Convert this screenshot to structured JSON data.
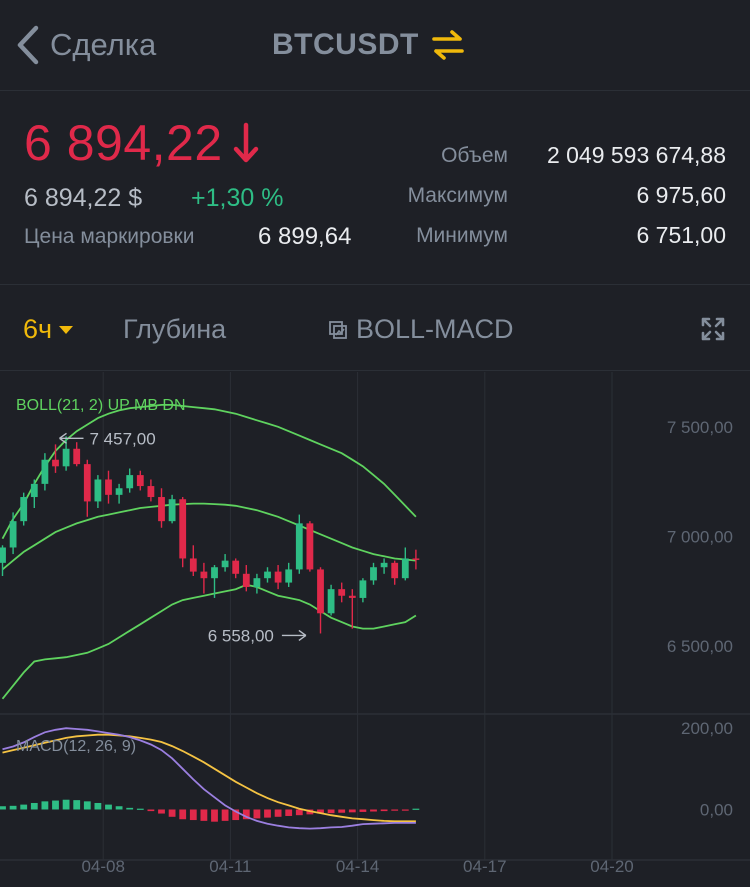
{
  "header": {
    "back_label": "Сделка",
    "pair": "BTCUSDT",
    "back_icon": "chevron-left-icon",
    "swap_icon": "swap-arrows-icon"
  },
  "ticker": {
    "last_price": "6 894,22",
    "last_price_usd": "6 894,22 $",
    "change_percent": "+1,30 %",
    "mark_price_label": "Цена маркировки",
    "mark_price_value": "6 899,64",
    "stats": [
      {
        "label": "Объем",
        "value": "2 049 593 674,88"
      },
      {
        "label": "Максимум",
        "value": "6 975,60"
      },
      {
        "label": "Минимум",
        "value": "6 751,00"
      }
    ]
  },
  "tabs": {
    "interval": "6ч",
    "depth": "Глубина",
    "indicator": "BOLL-MACD"
  },
  "colors": {
    "background": "#1e2026",
    "up": "#2ebd85",
    "down": "#e0294a",
    "accent": "#f0b90b",
    "boll": "#5fd35f",
    "macd_line": "#f5c343",
    "signal_line": "#9b7fe0"
  },
  "chart_data": [
    {
      "type": "candlestick",
      "legend": "BOLL(21, 2) UP MB DN",
      "ylim": [
        6200,
        7750
      ],
      "y_ticks": [
        "7 500,00",
        "7 000,00",
        "6 500,00"
      ],
      "y_tick_values": [
        7500,
        7000,
        6500
      ],
      "x_ticks": [
        "04-08",
        "04-11",
        "04-14",
        "04-17",
        "04-20"
      ],
      "x_tick_values": [
        9.5,
        21.5,
        33.5,
        45.5,
        57.5
      ],
      "annotations": [
        {
          "text": "7 457,00",
          "index": 5,
          "value": 7457
        },
        {
          "text": "6 558,00",
          "index": 29,
          "value": 6558
        }
      ],
      "candles": [
        {
          "o": 6880,
          "h": 6960,
          "l": 6820,
          "c": 6950
        },
        {
          "o": 6950,
          "h": 7110,
          "l": 6920,
          "c": 7070
        },
        {
          "o": 7070,
          "h": 7200,
          "l": 7050,
          "c": 7180
        },
        {
          "o": 7180,
          "h": 7260,
          "l": 7130,
          "c": 7240
        },
        {
          "o": 7240,
          "h": 7380,
          "l": 7210,
          "c": 7350
        },
        {
          "o": 7350,
          "h": 7420,
          "l": 7290,
          "c": 7320
        },
        {
          "o": 7320,
          "h": 7457,
          "l": 7300,
          "c": 7400
        },
        {
          "o": 7400,
          "h": 7430,
          "l": 7320,
          "c": 7330
        },
        {
          "o": 7330,
          "h": 7350,
          "l": 7090,
          "c": 7160
        },
        {
          "o": 7160,
          "h": 7280,
          "l": 7130,
          "c": 7260
        },
        {
          "o": 7260,
          "h": 7300,
          "l": 7150,
          "c": 7190
        },
        {
          "o": 7190,
          "h": 7240,
          "l": 7150,
          "c": 7220
        },
        {
          "o": 7220,
          "h": 7310,
          "l": 7200,
          "c": 7280
        },
        {
          "o": 7280,
          "h": 7300,
          "l": 7210,
          "c": 7230
        },
        {
          "o": 7230,
          "h": 7260,
          "l": 7160,
          "c": 7180
        },
        {
          "o": 7180,
          "h": 7220,
          "l": 7040,
          "c": 7070
        },
        {
          "o": 7070,
          "h": 7190,
          "l": 7060,
          "c": 7170
        },
        {
          "o": 7170,
          "h": 7180,
          "l": 6860,
          "c": 6900
        },
        {
          "o": 6900,
          "h": 6960,
          "l": 6820,
          "c": 6840
        },
        {
          "o": 6840,
          "h": 6880,
          "l": 6740,
          "c": 6810
        },
        {
          "o": 6810,
          "h": 6870,
          "l": 6720,
          "c": 6860
        },
        {
          "o": 6860,
          "h": 6920,
          "l": 6840,
          "c": 6890
        },
        {
          "o": 6890,
          "h": 6900,
          "l": 6810,
          "c": 6830
        },
        {
          "o": 6830,
          "h": 6870,
          "l": 6750,
          "c": 6770
        },
        {
          "o": 6770,
          "h": 6830,
          "l": 6740,
          "c": 6810
        },
        {
          "o": 6810,
          "h": 6860,
          "l": 6790,
          "c": 6840
        },
        {
          "o": 6840,
          "h": 6870,
          "l": 6760,
          "c": 6790
        },
        {
          "o": 6790,
          "h": 6880,
          "l": 6770,
          "c": 6850
        },
        {
          "o": 6850,
          "h": 7100,
          "l": 6830,
          "c": 7060
        },
        {
          "o": 7060,
          "h": 7070,
          "l": 6840,
          "c": 6850
        },
        {
          "o": 6850,
          "h": 6860,
          "l": 6558,
          "c": 6650
        },
        {
          "o": 6650,
          "h": 6780,
          "l": 6640,
          "c": 6760
        },
        {
          "o": 6760,
          "h": 6790,
          "l": 6700,
          "c": 6730
        },
        {
          "o": 6730,
          "h": 6760,
          "l": 6580,
          "c": 6720
        },
        {
          "o": 6720,
          "h": 6810,
          "l": 6700,
          "c": 6800
        },
        {
          "o": 6800,
          "h": 6880,
          "l": 6780,
          "c": 6860
        },
        {
          "o": 6860,
          "h": 6900,
          "l": 6830,
          "c": 6880
        },
        {
          "o": 6880,
          "h": 6890,
          "l": 6780,
          "c": 6810
        },
        {
          "o": 6810,
          "h": 6950,
          "l": 6800,
          "c": 6900
        },
        {
          "o": 6900,
          "h": 6940,
          "l": 6850,
          "c": 6894
        }
      ],
      "boll_up": [
        6990,
        7080,
        7150,
        7240,
        7320,
        7390,
        7440,
        7480,
        7510,
        7540,
        7560,
        7575,
        7585,
        7590,
        7595,
        7600,
        7600,
        7595,
        7590,
        7585,
        7580,
        7570,
        7560,
        7545,
        7530,
        7515,
        7500,
        7480,
        7460,
        7440,
        7420,
        7400,
        7380,
        7350,
        7320,
        7280,
        7240,
        7190,
        7140,
        7090
      ],
      "boll_mb": [
        6850,
        6890,
        6930,
        6960,
        6990,
        7020,
        7040,
        7060,
        7075,
        7090,
        7100,
        7110,
        7120,
        7130,
        7135,
        7140,
        7145,
        7148,
        7150,
        7150,
        7148,
        7145,
        7140,
        7130,
        7120,
        7105,
        7090,
        7070,
        7050,
        7030,
        7010,
        6990,
        6970,
        6950,
        6935,
        6920,
        6910,
        6900,
        6895,
        6890
      ],
      "boll_dn": [
        6260,
        6320,
        6380,
        6430,
        6440,
        6445,
        6450,
        6460,
        6470,
        6490,
        6510,
        6540,
        6570,
        6600,
        6630,
        6660,
        6690,
        6710,
        6720,
        6730,
        6740,
        6750,
        6760,
        6780,
        6770,
        6750,
        6730,
        6720,
        6710,
        6690,
        6660,
        6630,
        6610,
        6590,
        6580,
        6580,
        6590,
        6600,
        6610,
        6640
      ]
    },
    {
      "type": "macd",
      "legend": "MACD(12, 26, 9)",
      "ylim": [
        -80,
        230
      ],
      "y_ticks": [
        "200,00",
        "0,00"
      ],
      "y_tick_values": [
        200,
        0
      ],
      "x_ticks": [
        "04-08",
        "04-11",
        "04-14",
        "04-17",
        "04-20"
      ],
      "x_tick_values": [
        9.5,
        21.5,
        33.5,
        45.5,
        57.5
      ],
      "macd": [
        148,
        155,
        165,
        178,
        190,
        196,
        200,
        198,
        196,
        192,
        188,
        184,
        178,
        170,
        160,
        146,
        126,
        100,
        74,
        50,
        30,
        10,
        -5,
        -18,
        -28,
        -35,
        -40,
        -44,
        -46,
        -47,
        -46,
        -44,
        -43,
        -40,
        -36,
        -35,
        -34,
        -33,
        -33,
        -33
      ],
      "signal": [
        140,
        146,
        152,
        158,
        164,
        170,
        176,
        180,
        182,
        184,
        184,
        182,
        180,
        176,
        172,
        166,
        156,
        144,
        130,
        116,
        100,
        84,
        68,
        54,
        40,
        28,
        18,
        10,
        2,
        -4,
        -9,
        -14,
        -18,
        -22,
        -24,
        -26,
        -28,
        -29,
        -29,
        -29
      ],
      "histogram": [
        8,
        9,
        12,
        16,
        20,
        22,
        24,
        23,
        20,
        16,
        12,
        8,
        4,
        2,
        -4,
        -10,
        -18,
        -24,
        -26,
        -28,
        -30,
        -28,
        -26,
        -24,
        -22,
        -20,
        -18,
        -16,
        -14,
        -12,
        -10,
        -9,
        -8,
        -7,
        -6,
        -5,
        -4,
        -3,
        -2,
        2
      ]
    }
  ]
}
